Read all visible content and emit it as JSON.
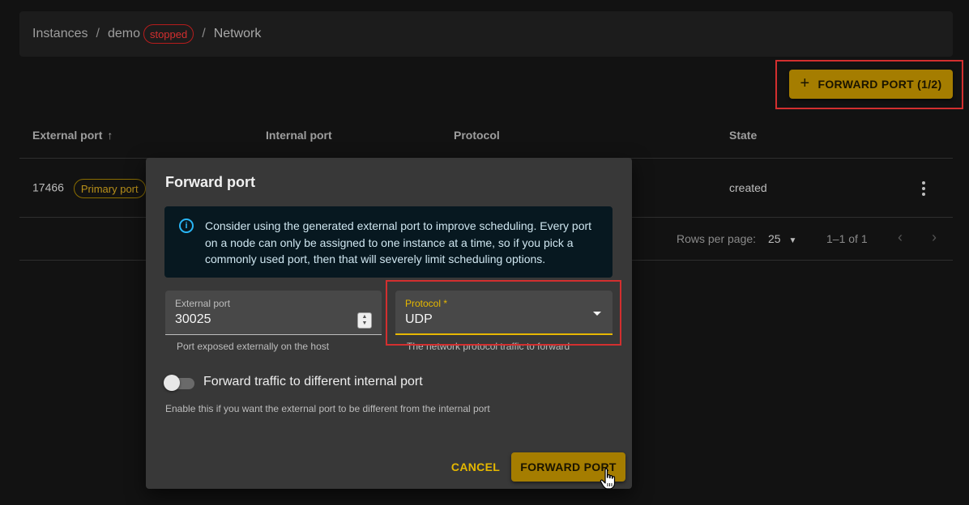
{
  "breadcrumb": {
    "instances": "Instances",
    "separator": "/",
    "instance": "demo",
    "status": "stopped",
    "current": "Network"
  },
  "toolbar": {
    "forward_port_label": "FORWARD PORT (1/2)",
    "plus_icon": "+"
  },
  "table": {
    "columns": [
      "External port",
      "Internal port",
      "Protocol",
      "State"
    ],
    "sort_icon": "arrow-up-icon",
    "rows": [
      {
        "external_port": "17466",
        "badge": "Primary port",
        "state": "created"
      }
    ]
  },
  "pagination": {
    "rows_per_page_label": "Rows per page:",
    "rows_per_page_value": "25",
    "range": "1–1 of 1"
  },
  "dialog": {
    "title": "Forward port",
    "info": "Consider using the generated external port to improve scheduling. Every port on a node can only be assigned to one instance at a time, so if you pick a commonly used port, then that will severely limit scheduling options.",
    "external_port": {
      "label": "External port",
      "value": "30025",
      "helper": "Port exposed externally on the host"
    },
    "protocol": {
      "label": "Protocol *",
      "value": "UDP",
      "helper": "The network protocol traffic to forward"
    },
    "toggle": {
      "label": "Forward traffic to different internal port",
      "helper": "Enable this if you want the external port to be different from the internal port",
      "checked": false
    },
    "cancel_label": "CANCEL",
    "submit_label": "FORWARD PORT"
  },
  "colors": {
    "accent": "#a57d00",
    "accent_text": "#e6b800",
    "error": "#d32f2f",
    "info": "#29b6f6"
  }
}
